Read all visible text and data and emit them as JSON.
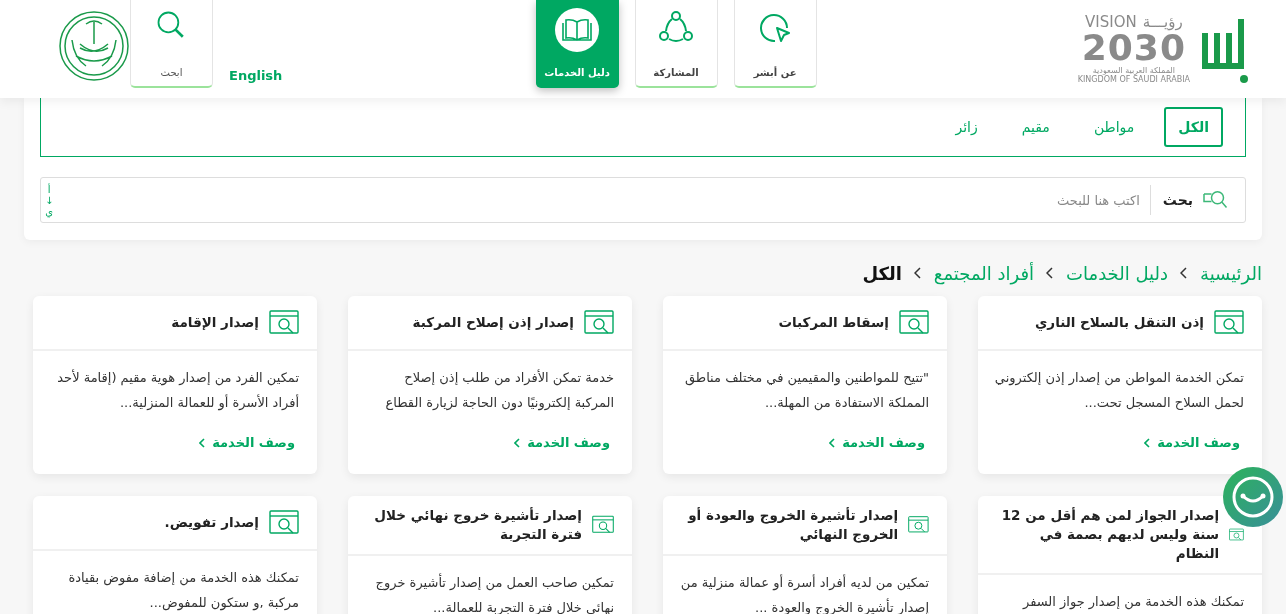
{
  "header": {
    "vision_logo": {
      "word": "VISION",
      "arabic": "رؤيـــة",
      "year": "2030",
      "country_ar": "المملكة العربية السعودية",
      "country_en": "KINGDOM OF SAUDI ARABIA"
    },
    "nav": [
      {
        "label": "عن أبشر",
        "kind": "about",
        "selected": false
      },
      {
        "label": "المشاركة",
        "kind": "share",
        "selected": false
      },
      {
        "label": "دليل الخدمات",
        "kind": "guide",
        "selected": true
      }
    ],
    "language": "English",
    "search_button": "ابحث"
  },
  "filters": {
    "tabs": [
      {
        "label": "الكل",
        "selected": true
      },
      {
        "label": "مواطن",
        "selected": false
      },
      {
        "label": "مقيم",
        "selected": false
      },
      {
        "label": "زائر",
        "selected": false
      }
    ],
    "search": {
      "label": "بحث",
      "placeholder": "اكتب هنا للبحث"
    },
    "sort": [
      "أ",
      "↓",
      "ي"
    ]
  },
  "breadcrumb": [
    {
      "label": "الرئيسية",
      "selected": false
    },
    {
      "label": "دليل الخدمات",
      "selected": false
    },
    {
      "label": "أفراد المجتمع",
      "selected": false
    },
    {
      "label": "الكل",
      "selected": true
    }
  ],
  "cards": [
    {
      "title": "إذن التنقل بالسلاح الناري",
      "description": "تمكن الخدمة المواطن من إصدار إذن إلكتروني لحمل السلاح المسجل تحت...",
      "link": "وصف الخدمة"
    },
    {
      "title": "إسقاط المركبات",
      "description": "\"تتيح للمواطنين والمقيمين في مختلف مناطق المملكة الاستفادة من المهلة...",
      "link": "وصف الخدمة"
    },
    {
      "title": "إصدار إذن إصلاح المركبة",
      "description": "خدمة تمكن الأفراد من طلب إذن إصلاح المركبة إلكترونيًا دون الحاجة لزيارة القطاع",
      "link": "وصف الخدمة"
    },
    {
      "title": "إصدار الإقامة",
      "description": "تمكين الفرد من إصدار هوية مقيم (إقامة لأحد أفراد الأسرة أو للعمالة المنزلية...",
      "link": "وصف الخدمة"
    },
    {
      "title": "إصدار الجواز لمن هم أقل من 12 سنة وليس لديهم بصمة في النظام",
      "description": "تمكنك هذه الخدمة من إصدار جواز السفر"
    },
    {
      "title": "إصدار تأشيرة الخروج والعودة أو الخروج النهائي",
      "description": "تمكين من لديه أفراد أسرة أو عمالة منزلية من إصدار تأشيرة الخروج والعودة ..."
    },
    {
      "title": "إصدار تأشيرة خروج نهائي خلال فترة التجربة",
      "description": "تمكين صاحب العمل من إصدار تأشيرة خروج نهائي خلال فترة التجربة للعمالة..."
    },
    {
      "title": "إصدار تفويض.",
      "description": "تمكنك هذه الخدمة من إضافة مفوض بقيادة مركبة ,و ستكون للمفوض..."
    }
  ]
}
